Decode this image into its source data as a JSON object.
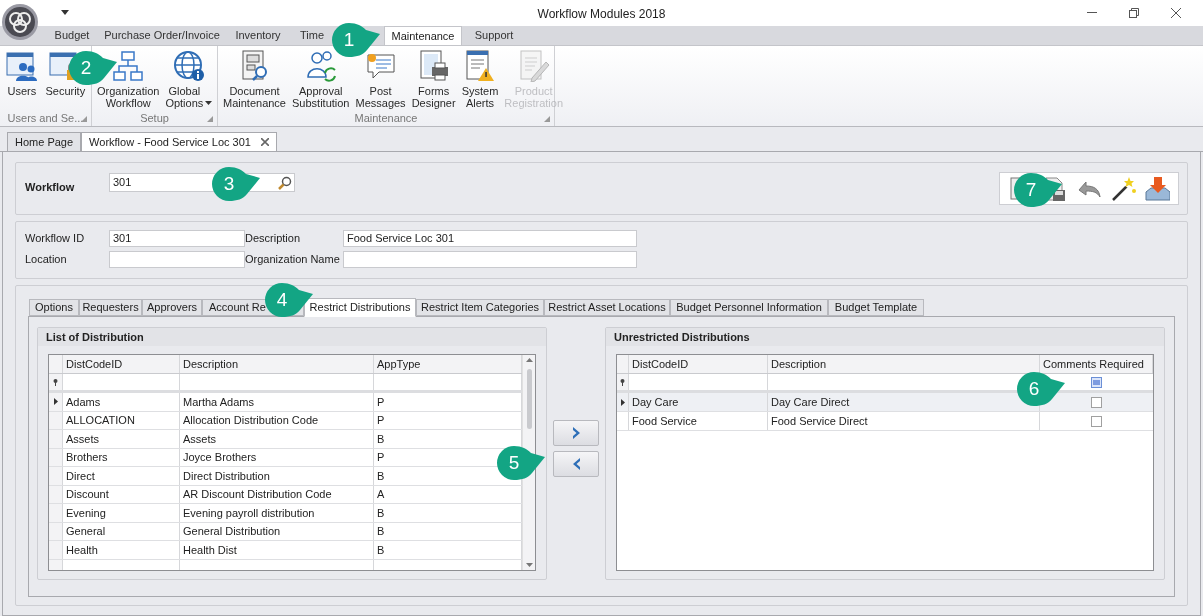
{
  "window": {
    "title": "Workflow Modules 2018"
  },
  "ribbon_tabs": [
    {
      "label": "Budget",
      "selected": false
    },
    {
      "label": "Purchase Order/Invoice",
      "selected": false
    },
    {
      "label": "Inventory",
      "selected": false
    },
    {
      "label": "Time",
      "selected": false
    },
    {
      "label": "Maintenance",
      "selected": true
    },
    {
      "label": "Support",
      "selected": false
    }
  ],
  "ribbon_groups": [
    {
      "label": "Users and Se...",
      "items": [
        {
          "lines": [
            "Users"
          ],
          "disabled": false
        },
        {
          "lines": [
            "Security"
          ],
          "disabled": false
        }
      ]
    },
    {
      "label": "Setup",
      "items": [
        {
          "lines": [
            "Organization",
            "Workflow"
          ],
          "disabled": false
        },
        {
          "lines": [
            "Global",
            "Options"
          ],
          "disabled": false,
          "dropdown": true
        }
      ]
    },
    {
      "label": "Maintenance",
      "items": [
        {
          "lines": [
            "Document",
            "Maintenance"
          ],
          "disabled": false
        },
        {
          "lines": [
            "Approval",
            "Substitution"
          ],
          "disabled": false
        },
        {
          "lines": [
            "Post",
            "Messages"
          ],
          "disabled": false
        },
        {
          "lines": [
            "Forms",
            "Designer"
          ],
          "disabled": false
        },
        {
          "lines": [
            "System",
            "Alerts"
          ],
          "disabled": false
        },
        {
          "lines": [
            "Product",
            "Registration"
          ],
          "disabled": true
        }
      ]
    }
  ],
  "document_tabs": [
    {
      "label": "Home Page",
      "selected": false
    },
    {
      "label": "Workflow - Food Service Loc 301",
      "selected": true,
      "closable": true
    }
  ],
  "workflow_search": {
    "label": "Workflow",
    "value": "301"
  },
  "details": {
    "workflow_id": {
      "label": "Workflow ID",
      "value": "301"
    },
    "description": {
      "label": "Description",
      "value": "Food Service Loc 301"
    },
    "location": {
      "label": "Location"
    },
    "organization_name": {
      "label": "Organization Name"
    }
  },
  "detail_tabs": [
    {
      "label": "Options",
      "selected": false
    },
    {
      "label": "Requesters",
      "selected": false
    },
    {
      "label": "Approvers",
      "selected": false
    },
    {
      "label": "Account Re",
      "selected": false
    },
    {
      "label": "Restrict Distributions",
      "selected": true
    },
    {
      "label": "Restrict Item Categories",
      "selected": false
    },
    {
      "label": "Restrict Asset Locations",
      "selected": false
    },
    {
      "label": "Budget Personnel Information",
      "selected": false
    },
    {
      "label": "Budget Template",
      "selected": false
    }
  ],
  "list_of_distribution": {
    "title": "List of Distribution",
    "columns": [
      "DistCodeID",
      "Description",
      "AppType"
    ],
    "rows": [
      {
        "cells": [
          "Adams",
          "Martha Adams",
          "P"
        ],
        "current": true
      },
      {
        "cells": [
          "ALLOCATION",
          "Allocation Distribution Code",
          "P"
        ],
        "current": false
      },
      {
        "cells": [
          "Assets",
          "Assets",
          "B"
        ],
        "current": false
      },
      {
        "cells": [
          "Brothers",
          "Joyce Brothers",
          "P"
        ],
        "current": false
      },
      {
        "cells": [
          "Direct",
          "Direct Distribution",
          "B"
        ],
        "current": false
      },
      {
        "cells": [
          "Discount",
          "AR Discount Distribution Code",
          "A"
        ],
        "current": false
      },
      {
        "cells": [
          "Evening",
          "Evening payroll distribution",
          "B"
        ],
        "current": false
      },
      {
        "cells": [
          "General",
          "General Distribution",
          "B"
        ],
        "current": false
      },
      {
        "cells": [
          "Health",
          "Health Dist",
          "B"
        ],
        "current": false
      }
    ]
  },
  "unrestricted_distributions": {
    "title": "Unrestricted Distributions",
    "columns": [
      "DistCodeID",
      "Description",
      "Comments Required"
    ],
    "filter_checkbox_indeterminate": true,
    "rows": [
      {
        "cells": [
          "Day Care",
          "Day Care Direct"
        ],
        "comments_required": false,
        "current": true
      },
      {
        "cells": [
          "Food Service",
          "Food Service Direct"
        ],
        "comments_required": false,
        "current": false
      }
    ]
  },
  "callouts": [
    {
      "number": "1"
    },
    {
      "number": "2"
    },
    {
      "number": "3"
    },
    {
      "number": "4"
    },
    {
      "number": "5"
    },
    {
      "number": "6"
    },
    {
      "number": "7"
    }
  ]
}
